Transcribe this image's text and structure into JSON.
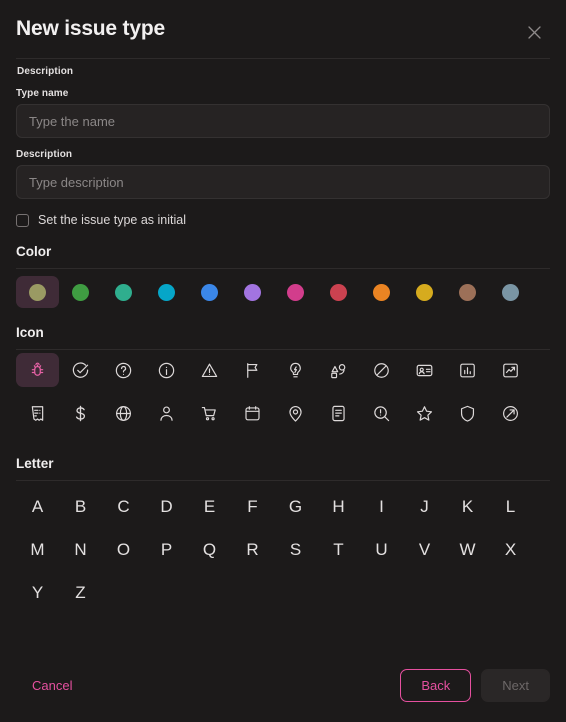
{
  "dialog": {
    "title": "New issue type",
    "close_icon": "close-icon"
  },
  "description_section": {
    "label": "Description"
  },
  "form": {
    "type_name": {
      "label": "Type name",
      "placeholder": "Type the name",
      "value": ""
    },
    "description": {
      "label": "Description",
      "placeholder": "Type description",
      "value": ""
    },
    "initial_checkbox": {
      "label": "Set the issue type as initial",
      "checked": false
    }
  },
  "color_section": {
    "heading": "Color",
    "selected_index": 0,
    "selected_bg": "#3f2b37",
    "swatches": [
      {
        "name": "olive",
        "hex": "#9a9a63"
      },
      {
        "name": "green",
        "hex": "#3f9c42"
      },
      {
        "name": "teal",
        "hex": "#2fae8e"
      },
      {
        "name": "cyan",
        "hex": "#06a6c8"
      },
      {
        "name": "blue",
        "hex": "#3b87e8"
      },
      {
        "name": "purple",
        "hex": "#a274e0"
      },
      {
        "name": "magenta",
        "hex": "#d23d8c"
      },
      {
        "name": "red",
        "hex": "#cb4250"
      },
      {
        "name": "orange",
        "hex": "#ea8423"
      },
      {
        "name": "yellow",
        "hex": "#d6ab1e"
      },
      {
        "name": "brown",
        "hex": "#9c7058"
      },
      {
        "name": "slate-blue",
        "hex": "#7a95a4"
      }
    ]
  },
  "icon_section": {
    "heading": "Icon",
    "selected_index": 0,
    "selected_bg": "#3f2b37",
    "selected_color": "#e862a6",
    "icons": [
      "bug-icon",
      "check-circle-icon",
      "question-circle-icon",
      "info-circle-icon",
      "warning-triangle-icon",
      "flag-icon",
      "lightbulb-icon",
      "shapes-icon",
      "blocked-circle-icon",
      "id-card-icon",
      "bar-chart-icon",
      "trend-chart-icon",
      "receipt-icon",
      "dollar-icon",
      "globe-icon",
      "user-icon",
      "shopping-cart-icon",
      "calendar-icon",
      "map-pin-icon",
      "document-icon",
      "search-alert-icon",
      "star-icon",
      "shield-icon",
      "arrow-circle-icon"
    ]
  },
  "letter_section": {
    "heading": "Letter",
    "letters": [
      "A",
      "B",
      "C",
      "D",
      "E",
      "F",
      "G",
      "H",
      "I",
      "J",
      "K",
      "L",
      "M",
      "N",
      "O",
      "P",
      "Q",
      "R",
      "S",
      "T",
      "U",
      "V",
      "W",
      "X",
      "Y",
      "Z"
    ]
  },
  "footer": {
    "cancel_label": "Cancel",
    "back_label": "Back",
    "next_label": "Next",
    "accent": "#e5509f"
  }
}
